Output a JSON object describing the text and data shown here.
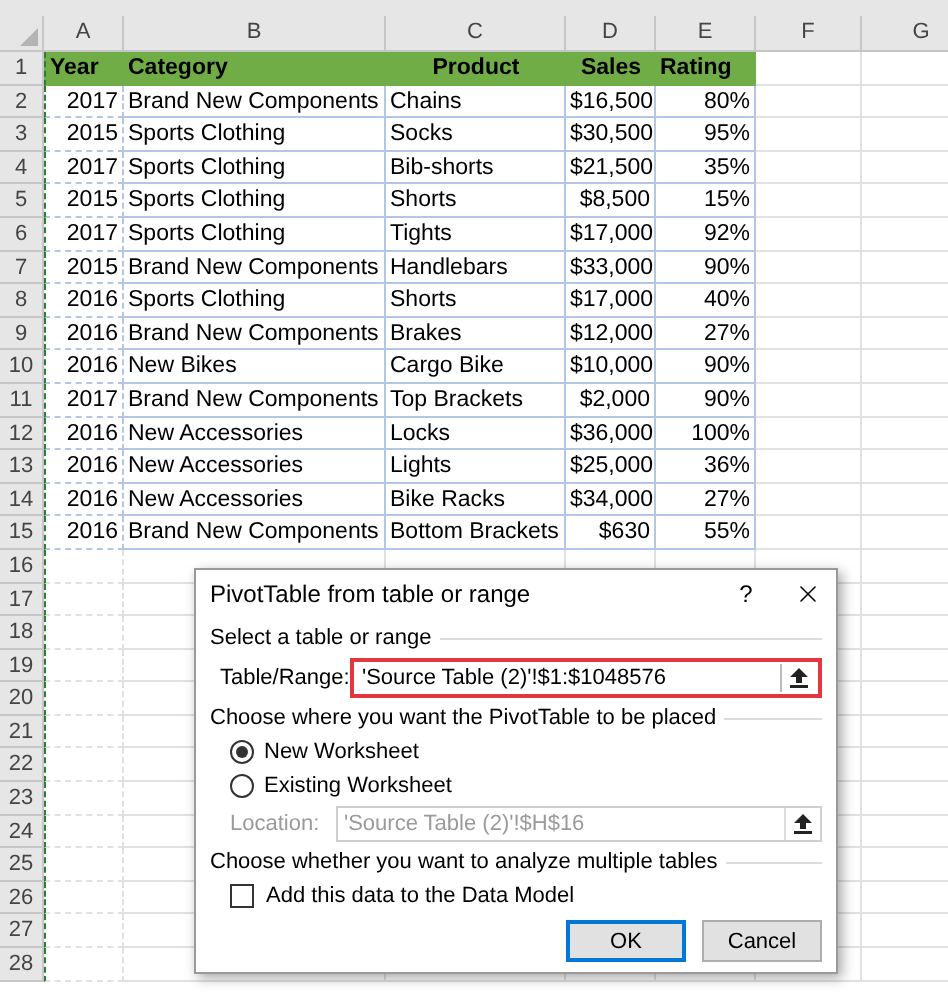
{
  "sheet": {
    "columns": [
      "A",
      "B",
      "C",
      "D",
      "E",
      "F",
      "G"
    ],
    "rows": [
      {
        "number": "1",
        "header": true,
        "cells": [
          "Year",
          "Category",
          "Product",
          "Sales",
          "Rating"
        ]
      },
      {
        "number": "2",
        "cells": [
          "2017",
          "Brand New Components",
          "Chains",
          "$16,500",
          "80%"
        ]
      },
      {
        "number": "3",
        "cells": [
          "2015",
          "Sports Clothing",
          "Socks",
          "$30,500",
          "95%"
        ]
      },
      {
        "number": "4",
        "cells": [
          "2017",
          "Sports Clothing",
          "Bib-shorts",
          "$21,500",
          "35%"
        ]
      },
      {
        "number": "5",
        "cells": [
          "2015",
          "Sports Clothing",
          "Shorts",
          "$8,500",
          "15%"
        ]
      },
      {
        "number": "6",
        "cells": [
          "2017",
          "Sports Clothing",
          "Tights",
          "$17,000",
          "92%"
        ]
      },
      {
        "number": "7",
        "cells": [
          "2015",
          "Brand New Components",
          "Handlebars",
          "$33,000",
          "90%"
        ]
      },
      {
        "number": "8",
        "cells": [
          "2016",
          "Sports Clothing",
          "Shorts",
          "$17,000",
          "40%"
        ]
      },
      {
        "number": "9",
        "cells": [
          "2016",
          "Brand New Components",
          "Brakes",
          "$12,000",
          "27%"
        ]
      },
      {
        "number": "10",
        "cells": [
          "2016",
          "New Bikes",
          "Cargo Bike",
          "$10,000",
          "90%"
        ]
      },
      {
        "number": "11",
        "cells": [
          "2017",
          "Brand New Components",
          "Top Brackets",
          "$2,000",
          "90%"
        ]
      },
      {
        "number": "12",
        "cells": [
          "2016",
          "New Accessories",
          "Locks",
          "$36,000",
          "100%"
        ]
      },
      {
        "number": "13",
        "cells": [
          "2016",
          "New Accessories",
          "Lights",
          "$25,000",
          "36%"
        ]
      },
      {
        "number": "14",
        "cells": [
          "2016",
          "New Accessories",
          "Bike Racks",
          "$34,000",
          "27%"
        ]
      },
      {
        "number": "15",
        "cells": [
          "2016",
          "Brand New Components",
          "Bottom Brackets",
          "$630",
          "55%"
        ]
      },
      {
        "number": "16"
      },
      {
        "number": "17"
      },
      {
        "number": "18"
      },
      {
        "number": "19"
      },
      {
        "number": "20"
      },
      {
        "number": "21"
      },
      {
        "number": "22"
      },
      {
        "number": "23"
      },
      {
        "number": "24"
      },
      {
        "number": "25"
      },
      {
        "number": "26"
      },
      {
        "number": "27"
      },
      {
        "number": "28"
      }
    ]
  },
  "dialog": {
    "title": "PivotTable from table or range",
    "help": "?",
    "source": {
      "heading": "Select a table or range",
      "label": "Table/Range:",
      "value": "'Source Table (2)'!$1:$1048576",
      "highlighted": true
    },
    "placement": {
      "heading": "Choose where you want the PivotTable to be placed",
      "options": [
        {
          "label": "New Worksheet",
          "selected": true
        },
        {
          "label": "Existing Worksheet",
          "selected": false
        }
      ],
      "location": {
        "label": "Location:",
        "value": "'Source Table (2)'!$H$16",
        "disabled": true
      }
    },
    "multiple": {
      "heading": "Choose whether you want to analyze multiple tables",
      "checkbox": {
        "label": "Add this data to the Data Model",
        "checked": false
      }
    },
    "buttons": [
      {
        "label": "OK",
        "default": true
      },
      {
        "label": "Cancel",
        "default": false
      }
    ]
  }
}
